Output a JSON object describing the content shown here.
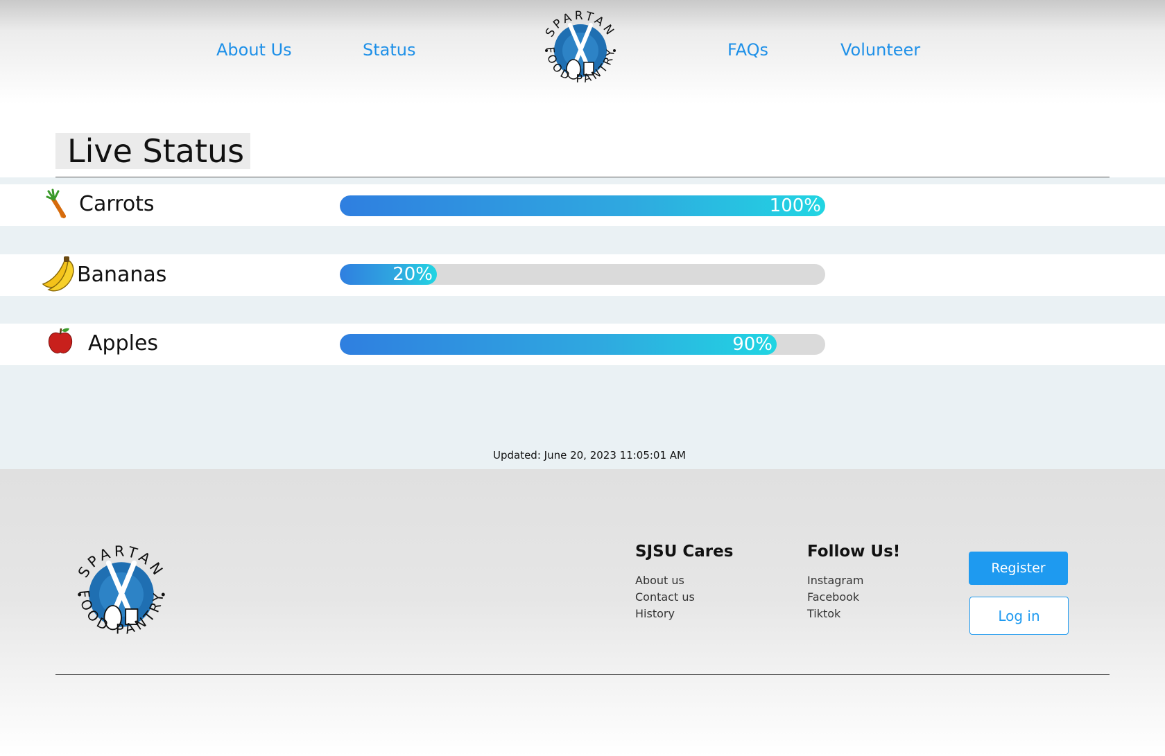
{
  "nav": {
    "left": [
      "About Us",
      "Status"
    ],
    "right": [
      "FAQs",
      "Volunteer"
    ]
  },
  "logo": {
    "top_text": "SPARTAN",
    "bottom_text": "FOOD PANTRY"
  },
  "status": {
    "title": "Live Status",
    "items": [
      {
        "name": "Carrots",
        "icon": "carrot-icon",
        "percent": 100,
        "label": "100%"
      },
      {
        "name": "Bananas",
        "icon": "banana-icon",
        "percent": 20,
        "label": "20%"
      },
      {
        "name": "Apples",
        "icon": "apple-icon",
        "percent": 90,
        "label": "90%"
      }
    ],
    "updated": "Updated: June 20, 2023 11:05:01 AM"
  },
  "footer": {
    "col1": {
      "heading": "SJSU Cares",
      "links": [
        "About us",
        "Contact us",
        "History"
      ]
    },
    "col2": {
      "heading": "Follow Us!",
      "links": [
        "Instagram",
        "Facebook",
        "Tiktok"
      ]
    },
    "register_label": "Register",
    "login_label": "Log in"
  },
  "colors": {
    "accent": "#1e9af0",
    "bar_start": "#2f7fe0",
    "bar_end": "#21d5e2",
    "logo_blue": "#1f6fb2"
  }
}
